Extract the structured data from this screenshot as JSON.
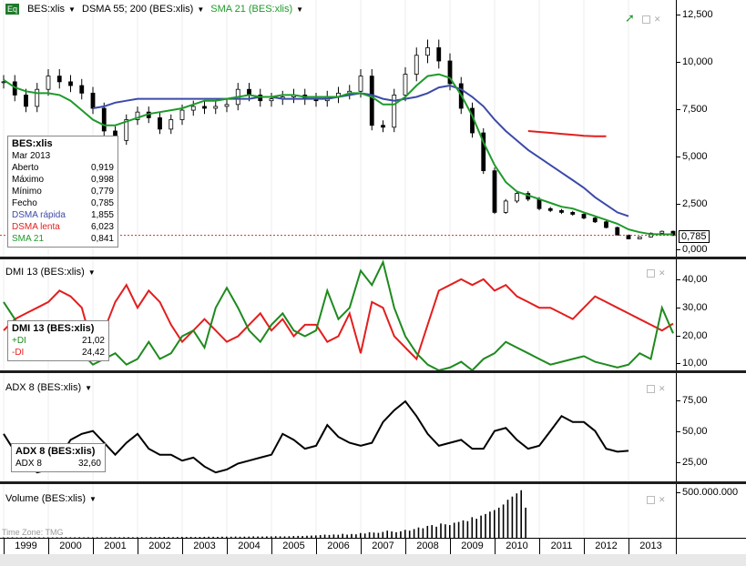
{
  "colors": {
    "price": "#000000",
    "dsma_fast": "#3b4aa8",
    "dsma_slow": "#e31e1e",
    "sma21": "#1e9a2a",
    "plus_di": "#1e8a1e",
    "minus_di": "#e31e1e",
    "adx": "#000000",
    "volume": "#000000",
    "marker_line": "#c0392b"
  },
  "icons": {
    "logo": "eq-badge-icon",
    "trend": "trend-arrow-icon",
    "menu": "chevron-down-icon",
    "window": "maximize-icon",
    "close": "close-icon"
  },
  "price_pane": {
    "logo_text": "Eq",
    "series_labels": [
      "BES:xlis",
      "DSMA 55; 200 (BES:xlis)",
      "SMA 21 (BES:xlis)"
    ],
    "last_value": "0,785",
    "info": {
      "title": "BES:xlis",
      "date": "Mar 2013",
      "rows": [
        {
          "label": "Aberto",
          "value": "0,919"
        },
        {
          "label": "Máximo",
          "value": "0,998"
        },
        {
          "label": "Mínimo",
          "value": "0,779"
        },
        {
          "label": "Fecho",
          "value": "0,785"
        },
        {
          "label": "DSMA rápida",
          "value": "1,855"
        },
        {
          "label": "DSMA lenta",
          "value": "6,023"
        },
        {
          "label": "SMA 21",
          "value": "0,841"
        }
      ]
    },
    "ticks": [
      "12,500",
      "10,000",
      "7,500",
      "5,000",
      "2,500",
      "0,000"
    ]
  },
  "dmi_pane": {
    "label": "DMI 13 (BES:xlis)",
    "info": {
      "title": "DMI 13 (BES:xlis)",
      "rows": [
        {
          "label": "+DI",
          "value": "21,02"
        },
        {
          "label": "-DI",
          "value": "24,42"
        }
      ]
    },
    "ticks": [
      "40,00",
      "30,00",
      "20,00",
      "10,00"
    ]
  },
  "adx_pane": {
    "label": "ADX 8 (BES:xlis)",
    "info": {
      "title": "ADX 8 (BES:xlis)",
      "rows": [
        {
          "label": "ADX 8",
          "value": "32,60"
        }
      ]
    },
    "ticks": [
      "75,00",
      "50,00",
      "25,00"
    ]
  },
  "volume_pane": {
    "label": "Volume (BES:xlis)",
    "tick": "500.000.000",
    "timezone": "Time Zone: TMG"
  },
  "years": [
    "1999",
    "2000",
    "2001",
    "2002",
    "2003",
    "2004",
    "2005",
    "2006",
    "2007",
    "2008",
    "2009",
    "2010",
    "2011",
    "2012",
    "2013"
  ],
  "chart_data": [
    {
      "type": "line",
      "title": "BES:xlis",
      "x_start": 1999.0,
      "x_step": 0.25,
      "ylim": [
        0,
        13000
      ],
      "series": [
        {
          "name": "BES:xlis",
          "values": [
            8.9,
            8.2,
            7.6,
            8.5,
            9.2,
            8.9,
            8.7,
            8.3,
            7.5,
            6.3,
            5.8,
            6.9,
            7.3,
            7.0,
            6.4,
            6.9,
            7.4,
            7.6,
            7.5,
            7.6,
            7.7,
            8.5,
            8.2,
            7.9,
            8.0,
            8.1,
            8.2,
            8.0,
            7.9,
            8.1,
            8.3,
            8.4,
            9.2,
            6.6,
            6.5,
            8.2,
            9.3,
            10.3,
            10.7,
            10.0,
            8.8,
            7.5,
            6.2,
            4.2,
            2.0,
            2.6,
            3.0,
            2.7,
            2.2,
            2.1,
            2.0,
            1.9,
            1.7,
            1.5,
            1.2,
            0.8,
            0.6,
            0.7,
            0.9,
            1.0,
            0.785
          ]
        },
        {
          "name": "SMA 21",
          "values": [
            9.0,
            8.6,
            8.4,
            8.3,
            8.3,
            8.2,
            7.9,
            7.4,
            6.9,
            6.6,
            6.6,
            6.8,
            7.0,
            7.2,
            7.3,
            7.4,
            7.5,
            7.7,
            7.9,
            7.9,
            8.0,
            8.1,
            8.2,
            8.1,
            8.1,
            8.2,
            8.2,
            8.1,
            8.1,
            8.1,
            8.1,
            8.3,
            8.3,
            8.1,
            7.7,
            7.7,
            8.1,
            8.7,
            9.2,
            9.3,
            9.1,
            8.2,
            7.1,
            5.7,
            4.5,
            3.6,
            3.1,
            2.9,
            2.7,
            2.5,
            2.3,
            2.2,
            2.0,
            1.8,
            1.6,
            1.4,
            1.1,
            0.95,
            0.85,
            0.84,
            0.841
          ]
        },
        {
          "name": "DSMA rápida",
          "values": [
            null,
            null,
            null,
            null,
            null,
            null,
            null,
            null,
            7.5,
            7.6,
            7.8,
            7.9,
            8.0,
            8.0,
            8.0,
            8.0,
            8.0,
            8.0,
            8.0,
            8.0,
            8.0,
            8.0,
            8.0,
            8.1,
            8.1,
            8.0,
            8.0,
            8.0,
            8.0,
            8.0,
            8.1,
            8.2,
            8.3,
            8.2,
            8.0,
            7.9,
            8.0,
            8.1,
            8.3,
            8.6,
            8.7,
            8.5,
            8.1,
            7.6,
            6.9,
            6.3,
            5.8,
            5.3,
            4.9,
            4.5,
            4.1,
            3.7,
            3.3,
            2.8,
            2.4,
            2.0,
            1.8
          ]
        },
        {
          "name": "DSMA lenta",
          "values": [
            null,
            null,
            null,
            null,
            null,
            null,
            null,
            null,
            null,
            null,
            null,
            null,
            null,
            null,
            null,
            null,
            null,
            null,
            null,
            null,
            null,
            null,
            null,
            null,
            null,
            null,
            null,
            null,
            null,
            null,
            null,
            null,
            null,
            null,
            null,
            null,
            null,
            null,
            null,
            null,
            null,
            null,
            null,
            null,
            null,
            null,
            null,
            6.3,
            6.25,
            6.2,
            6.15,
            6.1,
            6.05,
            6.02,
            6.023
          ]
        }
      ]
    },
    {
      "type": "line",
      "title": "DMI 13 (BES:xlis)",
      "x_start": 1999.0,
      "x_step": 0.25,
      "ylim": [
        8,
        47
      ],
      "series": [
        {
          "name": "+DI",
          "values": [
            32,
            26,
            20,
            16,
            14,
            12,
            16,
            14,
            10,
            12,
            14,
            10,
            12,
            18,
            12,
            14,
            20,
            22,
            16,
            30,
            37,
            30,
            22,
            18,
            24,
            28,
            22,
            20,
            22,
            36,
            26,
            30,
            43,
            38,
            46,
            30,
            20,
            14,
            10,
            8,
            9,
            11,
            8,
            12,
            14,
            18,
            16,
            14,
            12,
            10,
            11,
            12,
            13,
            11,
            10,
            9,
            10,
            14,
            12,
            30,
            21.02
          ]
        },
        {
          "name": "-DI",
          "values": [
            22,
            26,
            28,
            30,
            32,
            36,
            34,
            30,
            16,
            22,
            32,
            38,
            30,
            36,
            32,
            24,
            18,
            22,
            26,
            22,
            18,
            20,
            24,
            28,
            22,
            26,
            20,
            24,
            24,
            18,
            20,
            28,
            14,
            32,
            30,
            20,
            16,
            12,
            24,
            36,
            38,
            40,
            38,
            40,
            36,
            38,
            34,
            32,
            30,
            30,
            28,
            26,
            30,
            34,
            32,
            30,
            28,
            26,
            24,
            22,
            24.42
          ]
        }
      ]
    },
    {
      "type": "line",
      "title": "ADX 8 (BES:xlis)",
      "x_start": 1999.0,
      "x_step": 0.25,
      "ylim": [
        12,
        85
      ],
      "series": [
        {
          "name": "ADX 8",
          "values": [
            44,
            32,
            24,
            18,
            20,
            28,
            40,
            44,
            46,
            38,
            30,
            38,
            44,
            34,
            30,
            30,
            26,
            28,
            22,
            18,
            20,
            24,
            26,
            28,
            30,
            44,
            40,
            34,
            36,
            50,
            42,
            38,
            36,
            38,
            52,
            60,
            66,
            56,
            44,
            36,
            38,
            40,
            34,
            34,
            46,
            48,
            40,
            34,
            36,
            46,
            56,
            52,
            52,
            46,
            34,
            32,
            32.6
          ]
        }
      ]
    },
    {
      "type": "bar",
      "title": "Volume (BES:xlis)",
      "x_start": 1999.0,
      "x_step": 0.1,
      "ylim": [
        0,
        620000000
      ],
      "series": [
        {
          "name": "Volume",
          "values": [
            5,
            5,
            6,
            5,
            5,
            6,
            5,
            6,
            6,
            5,
            6,
            5,
            6,
            6,
            7,
            6,
            6,
            7,
            6,
            7,
            6,
            7,
            7,
            6,
            7,
            8,
            7,
            8,
            8,
            7,
            8,
            8,
            7,
            9,
            8,
            9,
            10,
            9,
            9,
            10,
            12,
            11,
            12,
            10,
            11,
            12,
            14,
            13,
            12,
            14,
            15,
            14,
            16,
            14,
            15,
            16,
            18,
            17,
            16,
            18,
            18,
            20,
            19,
            18,
            20,
            22,
            24,
            22,
            26,
            28,
            30,
            34,
            40,
            36,
            42,
            38,
            50,
            40,
            48,
            44,
            60,
            54,
            70,
            66,
            62,
            74,
            90,
            80,
            70,
            82,
            100,
            90,
            110,
            130,
            120,
            150,
            160,
            140,
            180,
            170,
            160,
            190,
            200,
            220,
            210,
            260,
            240,
            280,
            300,
            330,
            350,
            380,
            420,
            480,
            520,
            560,
            600,
            380
          ]
        }
      ]
    }
  ]
}
